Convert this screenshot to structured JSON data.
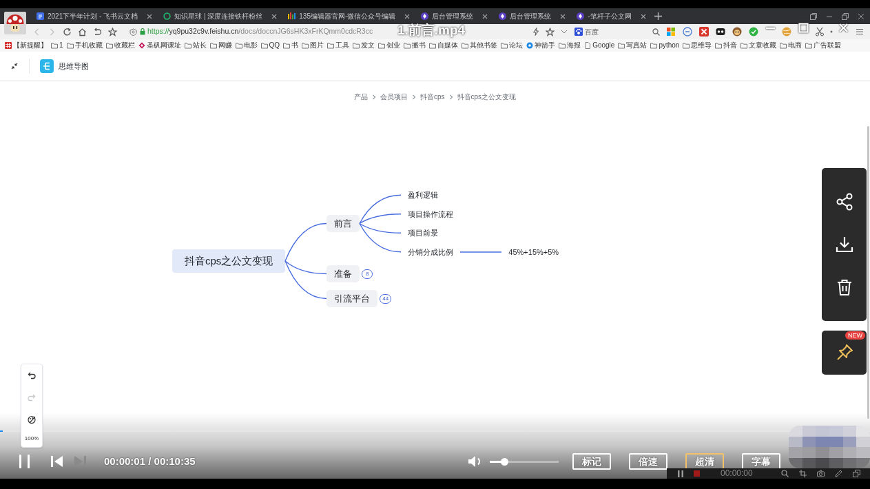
{
  "browser": {
    "tabs": [
      {
        "title": "2021下半年计划 - 飞书云文档",
        "kind": "doc"
      },
      {
        "title": "知识星球 | 深度连接铁杆粉丝",
        "kind": "ring"
      },
      {
        "title": "135编辑器官网-微信公众号编辑",
        "kind": "bars"
      },
      {
        "title": "后台管理系统",
        "kind": "logo"
      },
      {
        "title": "后台管理系统",
        "kind": "logo"
      },
      {
        "title": "-笔杆子公文网",
        "kind": "logo"
      }
    ],
    "address": {
      "scheme": "https://",
      "host": "yq9pu32c9v.feishu.cn",
      "path": "/docs/doccnJG6sHK3xFrKQmm0cdcR3cc"
    },
    "search": {
      "placeholder": "百度"
    },
    "bookmarks": [
      {
        "label": "【新提醒】",
        "kind": "special"
      },
      {
        "label": "1",
        "kind": "folder"
      },
      {
        "label": "手机收藏",
        "kind": "folder"
      },
      {
        "label": "收藏栏",
        "kind": "folder"
      },
      {
        "label": "圣矾网课址",
        "kind": "site"
      },
      {
        "label": "站长",
        "kind": "folder"
      },
      {
        "label": "网赚",
        "kind": "folder"
      },
      {
        "label": "电影",
        "kind": "folder"
      },
      {
        "label": "QQ",
        "kind": "folder"
      },
      {
        "label": "书",
        "kind": "folder"
      },
      {
        "label": "图片",
        "kind": "folder"
      },
      {
        "label": "工具",
        "kind": "folder"
      },
      {
        "label": "发文",
        "kind": "folder"
      },
      {
        "label": "创业",
        "kind": "folder"
      },
      {
        "label": "搬书",
        "kind": "folder"
      },
      {
        "label": "自媒体",
        "kind": "folder"
      },
      {
        "label": "其他书签",
        "kind": "folder"
      },
      {
        "label": "论坛",
        "kind": "folder"
      },
      {
        "label": "神箭手",
        "kind": "globe"
      },
      {
        "label": "海报",
        "kind": "folder"
      },
      {
        "label": "Google",
        "kind": "page"
      },
      {
        "label": "写真站",
        "kind": "folder"
      },
      {
        "label": "python",
        "kind": "folder"
      },
      {
        "label": "思维导",
        "kind": "folder"
      },
      {
        "label": "抖音",
        "kind": "folder"
      },
      {
        "label": "文章收藏",
        "kind": "folder"
      },
      {
        "label": "电商",
        "kind": "folder"
      },
      {
        "label": "广告联盟",
        "kind": "folder"
      }
    ]
  },
  "video": {
    "title": "1.前言.mp4",
    "playing": true,
    "progress": {
      "level": 0.003
    },
    "nav": [
      {
        "kind": "previous",
        "disabled": false
      },
      {
        "kind": "next",
        "disabled": true
      }
    ],
    "time": "00:00:01 / 00:10:35",
    "volume": {
      "level": 0.21
    },
    "buttons": [
      {
        "label": "标记",
        "selected": false
      },
      {
        "label": "倍速",
        "selected": false
      },
      {
        "label": "超清",
        "selected": true
      },
      {
        "label": "字幕",
        "selected": false
      }
    ]
  },
  "page": {
    "app_name": "思维导图",
    "breadcrumb": [
      "产品",
      "会员项目",
      "抖音cps",
      "抖音cps之公文变现"
    ],
    "mindmap": {
      "label": "抖音cps之公文变现",
      "children": [
        {
          "label": "前言",
          "expanded": true,
          "children": [
            {
              "label": "盈利逻辑"
            },
            {
              "label": "项目操作流程"
            },
            {
              "label": "项目前景"
            },
            {
              "label": "分销分成比例",
              "children": [
                {
                  "label": "45%+15%+5%"
                }
              ]
            }
          ]
        },
        {
          "label": "准备",
          "expanded": false,
          "count": "8"
        },
        {
          "label": "引流平台",
          "expanded": false,
          "count": "44"
        }
      ]
    },
    "zoom": {
      "redo": {
        "disabled": true
      },
      "value": "100%"
    },
    "pin_badge": "NEW"
  },
  "recorder": {
    "time": "00:00:00"
  }
}
